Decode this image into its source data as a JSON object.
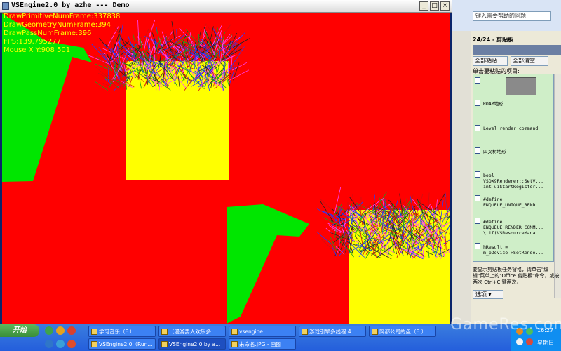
{
  "window": {
    "title": "VSEngine2.0 by azhe --- Demo",
    "minimize_glyph": "_",
    "maximize_glyph": "□",
    "close_glyph": "×"
  },
  "overlay": {
    "lines": [
      "DrawPrimitiveNumFrame:337838",
      "DrawGeometryNumFrame:394",
      "DrawPassNumFrame:396",
      "FPS:139.795277",
      "Mouse X Y:908 501"
    ]
  },
  "scene": {
    "background_color": "#ff0000",
    "wall_color": "#ffff00",
    "ground_color": "#00e600",
    "grass_colors": [
      "#1f3cff",
      "#18a018",
      "#d01010",
      "#222222",
      "#ff44ff"
    ]
  },
  "office": {
    "help_placeholder": "键入需要帮助的问题",
    "pane_title": "24/24 - 剪贴板",
    "paste_all": "全部粘贴",
    "clear_all": "全部清空",
    "hint": "单击要粘贴的项目:",
    "clips": [
      "",
      "ROAM地形",
      "Level render command",
      "四叉树地形",
      "bool\nVSDX9Renderer::SetV...\nint uiStartRegister...",
      "#define\nENQUEUE_UNIQUE_REND...",
      "#define\nENQUEUE_RENDER_COMM...\n\\ if(VSResourceMana...",
      "hResult =\nm_pDevice->SetRende..."
    ],
    "note": "要显示剪贴板任务窗格，请单击\"编辑\"菜单上的\"Office 剪贴板\"命令，或按两次 Ctrl+C 键两次。",
    "options": "选项 ▾"
  },
  "taskbar": {
    "start_label": "开始",
    "row1": [
      "学习音乐（F:）",
      "【漫游男人欢乐多",
      "vsengine",
      "游戏引擎多线程 4",
      "网都公司的盘（E:）"
    ],
    "row2": [
      "VSEngine2.0（Run...",
      "VSEngine2.0 by a...",
      "未命名.JPG - 画图"
    ],
    "clock": "16:27",
    "day": "星期日"
  },
  "watermark": "GameRes.com"
}
